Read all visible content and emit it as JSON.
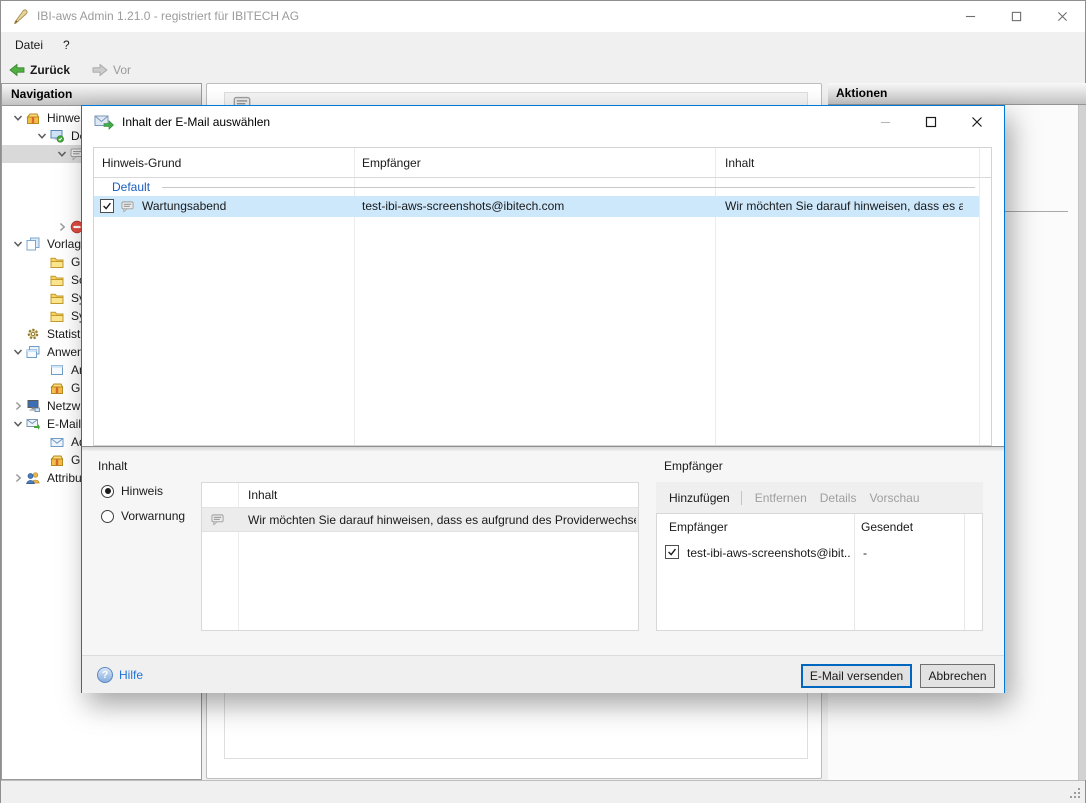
{
  "colors": {
    "accent_blue": "#0078d7",
    "row_selection_blue": "#cde8fb",
    "tree_selection_gray": "#d9d9d9",
    "group_text_blue": "#1b5ebe",
    "link_blue": "#2273d4",
    "back_arrow_green": "#52b043"
  },
  "window": {
    "title": "IBI-aws Admin 1.21.0 - registriert für IBITECH AG",
    "menu": {
      "file": "Datei",
      "help": "?"
    },
    "toolbar": {
      "back": "Zurück",
      "forward": "Vor"
    },
    "nav_header": "Navigation",
    "actions_header": "Aktionen",
    "tree": [
      {
        "label": "Hinwe",
        "icon": "package-icon"
      },
      {
        "label": "De",
        "icon": "monitor-check-icon"
      },
      {
        "label": "",
        "icon": "note-bubble-icon"
      },
      {
        "label": "",
        "icon": "blocked-icon"
      },
      {
        "label": "Vorlag",
        "icon": "templates-icon"
      },
      {
        "label": "Gl",
        "icon": "folder-icon"
      },
      {
        "label": "Sch",
        "icon": "folder-icon"
      },
      {
        "label": "Sy",
        "icon": "folder-icon"
      },
      {
        "label": "Sy",
        "icon": "folder-icon"
      },
      {
        "label": "Statisti",
        "icon": "gear-icon"
      },
      {
        "label": "Anwen",
        "icon": "app-windows-icon"
      },
      {
        "label": "An",
        "icon": "app-window-icon"
      },
      {
        "label": "Gr",
        "icon": "package-icon"
      },
      {
        "label": "Netzw",
        "icon": "network-icon"
      },
      {
        "label": "E-Mail",
        "icon": "mail-send-icon"
      },
      {
        "label": "Ad",
        "icon": "envelope-icon"
      },
      {
        "label": "Gr",
        "icon": "package-icon"
      },
      {
        "label": "Attribu",
        "icon": "users-icon"
      }
    ]
  },
  "dialog": {
    "title": "Inhalt der E-Mail auswählen",
    "grid": {
      "columns": {
        "reason": "Hinweis-Grund",
        "recipient": "Empfänger",
        "content": "Inhalt"
      },
      "group_label": "Default",
      "row": {
        "checked": true,
        "reason": "Wartungsabend",
        "recipient": "test-ibi-aws-screenshots@ibitech.com",
        "content": "Wir möchten Sie darauf hinweisen, dass es au..."
      }
    },
    "inhalt_group": {
      "label": "Inhalt",
      "radio_hinweis": "Hinweis",
      "radio_vorwarnung": "Vorwarnung",
      "column": "Inhalt",
      "row_text": "Wir möchten Sie darauf hinweisen, dass es aufgrund des Providerwechsels m..."
    },
    "empfaenger_group": {
      "label": "Empfänger",
      "toolbar": {
        "add": "Hinzufügen",
        "remove": "Entfernen",
        "details": "Details",
        "preview": "Vorschau"
      },
      "columns": {
        "recipient": "Empfänger",
        "sent": "Gesendet"
      },
      "row": {
        "checked": true,
        "recipient": "test-ibi-aws-screenshots@ibit...",
        "sent": "-"
      }
    },
    "footer": {
      "help": "Hilfe",
      "help_glyph": "?",
      "send": "E-Mail versenden",
      "cancel": "Abbrechen"
    }
  }
}
